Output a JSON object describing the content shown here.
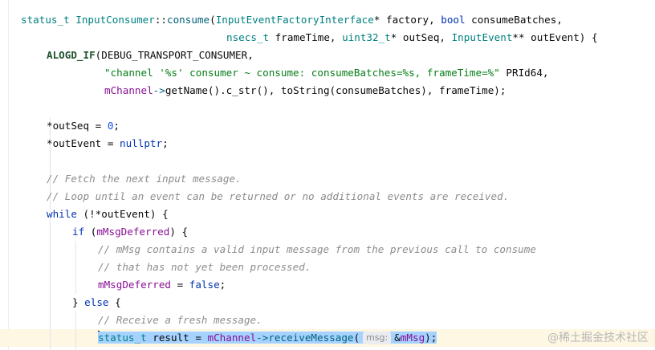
{
  "code": {
    "l1": {
      "t1": "status_t",
      "t2": " ",
      "t3": "InputConsumer",
      "t4": "::",
      "t5": "consume",
      "t6": "(",
      "t7": "InputEventFactoryInterface",
      "t8": "* factory, ",
      "t9": "bool",
      "t10": " consumeBatches,"
    },
    "l2": {
      "t1": "nsecs_t",
      "t2": " frameTime, ",
      "t3": "uint32_t",
      "t4": "* outSeq, ",
      "t5": "InputEvent",
      "t6": "** outEvent) {"
    },
    "l3": {
      "t1": "ALOGD_IF",
      "t2": "(DEBUG_TRANSPORT_CONSUMER,"
    },
    "l4": {
      "t1": "\"channel '%s' consumer ~ consume: consumeBatches=%s, frameTime=%\"",
      "t2": " PRId64,"
    },
    "l5": {
      "t1": "mChannel",
      "t2": "->",
      "t3": "getName().c_str(), toString(consumeBatches), frameTime);"
    },
    "l7": {
      "t1": "*outSeq = ",
      "t2": "0",
      "t3": ";"
    },
    "l8": {
      "t1": "*outEvent = ",
      "t2": "nullptr",
      "t3": ";"
    },
    "l10": {
      "t1": "// Fetch the next input message."
    },
    "l11": {
      "t1": "// Loop until an event can be returned or no additional events are received."
    },
    "l12": {
      "t1": "while",
      "t2": " (!*outEvent) {"
    },
    "l13": {
      "t1": "if",
      "t2": " (",
      "t3": "mMsgDeferred",
      "t4": ") {"
    },
    "l14": {
      "t1": "// mMsg contains a valid input message from the previous call to consume"
    },
    "l15": {
      "t1": "// that has not yet been processed."
    },
    "l16": {
      "t1": "mMsgDeferred",
      "t2": " = ",
      "t3": "false",
      "t4": ";"
    },
    "l17": {
      "t1": "} ",
      "t2": "else",
      "t3": " {"
    },
    "l18": {
      "t1": "// Receive a fresh message."
    },
    "l19": {
      "t1": "status_t",
      "t2": " result = ",
      "t3": "mChannel",
      "t4": "->",
      "t5": "receiveMessage",
      "t6": "(",
      "hint": "msg:",
      "t7": "&",
      "t8": "mMsg",
      "t9": ");"
    }
  },
  "watermark": "@稀土掘金技术社区"
}
